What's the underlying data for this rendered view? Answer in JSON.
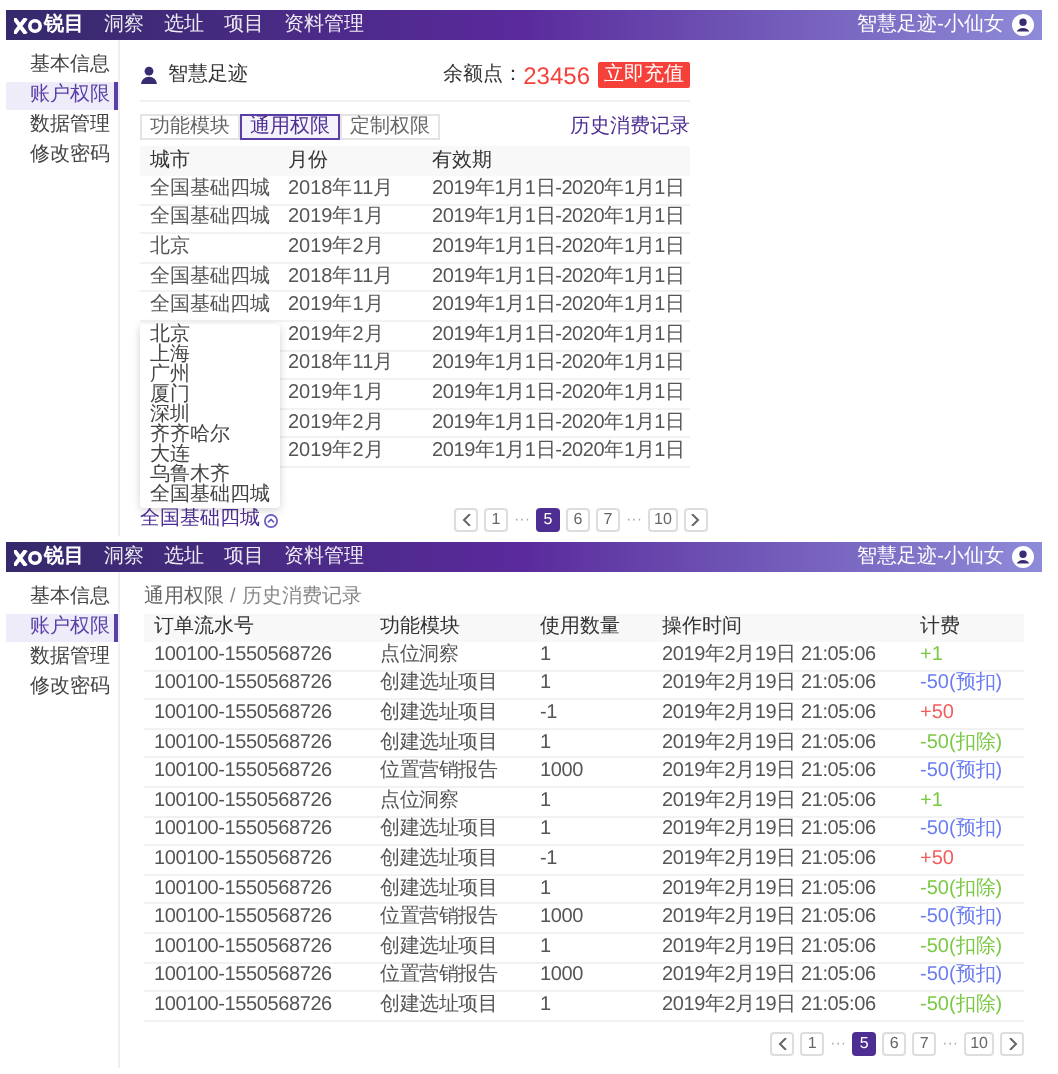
{
  "account_page": {
    "nav": {
      "logo": "锐目",
      "items": [
        "洞察",
        "选址",
        "项目",
        "资料管理"
      ],
      "user": "智慧足迹-小仙女"
    },
    "sidebar": [
      {
        "label": "基本信息",
        "selected": false
      },
      {
        "label": "账户权限",
        "selected": true
      },
      {
        "label": "数据管理",
        "selected": false
      },
      {
        "label": "修改密码",
        "selected": false
      }
    ],
    "account_name": "智慧足迹",
    "points_label": "余额点：",
    "points": "23456",
    "recharge_button": "立即充值",
    "tabs": [
      {
        "label": "功能模块",
        "selected": false
      },
      {
        "label": "通用权限",
        "selected": true
      },
      {
        "label": "定制权限",
        "selected": false
      }
    ],
    "history_link": "历史消费记录",
    "table": {
      "columns": [
        "城市",
        "月份",
        "有效期"
      ],
      "rows": [
        {
          "city": "全国基础四城",
          "month": "2018年11月",
          "validity": "2019年1月1日-2020年1月1日"
        },
        {
          "city": "全国基础四城",
          "month": "2019年1月",
          "validity": "2019年1月1日-2020年1月1日"
        },
        {
          "city": "北京",
          "month": "2019年2月",
          "validity": "2019年1月1日-2020年1月1日"
        },
        {
          "city": "全国基础四城",
          "month": "2018年11月",
          "validity": "2019年1月1日-2020年1月1日"
        },
        {
          "city": "全国基础四城",
          "month": "2019年1月",
          "validity": "2019年1月1日-2020年1月1日"
        },
        {
          "month": "2019年2月",
          "validity": "2019年1月1日-2020年1月1日"
        },
        {
          "month": "2018年11月",
          "validity": "2019年1月1日-2020年1月1日"
        },
        {
          "month": "2019年1月",
          "validity": "2019年1月1日-2020年1月1日"
        },
        {
          "month": "2019年2月",
          "validity": "2019年1月1日-2020年1月1日"
        },
        {
          "month": "2019年2月",
          "validity": "2019年1月1日-2020年1月1日"
        }
      ]
    },
    "city_dropdown": {
      "value": "全国基础四城",
      "expanded": true,
      "options": [
        "北京",
        "上海",
        "广州",
        "厦门",
        "深圳",
        "齐齐哈尔",
        "大连",
        "乌鲁木齐",
        "全国基础四城"
      ]
    },
    "pagination": [
      {
        "kind": "prev"
      },
      {
        "kind": "page",
        "label": "1",
        "selected": false
      },
      {
        "kind": "ellipsis",
        "label": "···"
      },
      {
        "kind": "page",
        "label": "5",
        "selected": true
      },
      {
        "kind": "page",
        "label": "6",
        "selected": false
      },
      {
        "kind": "page",
        "label": "7",
        "selected": false
      },
      {
        "kind": "ellipsis",
        "label": "···"
      },
      {
        "kind": "page",
        "label": "10",
        "selected": false
      },
      {
        "kind": "next"
      }
    ]
  },
  "history_page": {
    "nav": {
      "logo": "锐目",
      "items": [
        "洞察",
        "选址",
        "项目",
        "资料管理"
      ],
      "user": "智慧足迹-小仙女"
    },
    "sidebar": [
      {
        "label": "基本信息",
        "selected": false
      },
      {
        "label": "账户权限",
        "selected": true
      },
      {
        "label": "数据管理",
        "selected": false
      },
      {
        "label": "修改密码",
        "selected": false
      }
    ],
    "breadcrumb": [
      "通用权限",
      "/",
      "历史消费记录"
    ],
    "table": {
      "columns": [
        "订单流水号",
        "功能模块",
        "使用数量",
        "操作时间",
        "计费"
      ],
      "rows": [
        {
          "order": "100100-1550568726",
          "module": "点位洞察",
          "quantity": "1",
          "time": "2019年2月19日 21:05:06",
          "charge": "+1",
          "color": "#7ac943"
        },
        {
          "order": "100100-1550568726",
          "module": "创建选址项目",
          "quantity": "1",
          "time": "2019年2月19日 21:05:06",
          "charge": "-50(预扣)",
          "color": "#6b7cf0"
        },
        {
          "order": "100100-1550568726",
          "module": "创建选址项目",
          "quantity": "-1",
          "time": "2019年2月19日 21:05:06",
          "charge": "+50",
          "color": "#f25c5c"
        },
        {
          "order": "100100-1550568726",
          "module": "创建选址项目",
          "quantity": "1",
          "time": "2019年2月19日 21:05:06",
          "charge": "-50(扣除)",
          "color": "#7ac943"
        },
        {
          "order": "100100-1550568726",
          "module": "位置营销报告",
          "quantity": "1000",
          "time": "2019年2月19日 21:05:06",
          "charge": "-50(预扣)",
          "color": "#6b7cf0"
        },
        {
          "order": "100100-1550568726",
          "module": "点位洞察",
          "quantity": "1",
          "time": "2019年2月19日 21:05:06",
          "charge": "+1",
          "color": "#7ac943"
        },
        {
          "order": "100100-1550568726",
          "module": "创建选址项目",
          "quantity": "1",
          "time": "2019年2月19日 21:05:06",
          "charge": "-50(预扣)",
          "color": "#6b7cf0"
        },
        {
          "order": "100100-1550568726",
          "module": "创建选址项目",
          "quantity": "-1",
          "time": "2019年2月19日 21:05:06",
          "charge": "+50",
          "color": "#f25c5c"
        },
        {
          "order": "100100-1550568726",
          "module": "创建选址项目",
          "quantity": "1",
          "time": "2019年2月19日 21:05:06",
          "charge": "-50(扣除)",
          "color": "#7ac943"
        },
        {
          "order": "100100-1550568726",
          "module": "位置营销报告",
          "quantity": "1000",
          "time": "2019年2月19日 21:05:06",
          "charge": "-50(预扣)",
          "color": "#6b7cf0"
        },
        {
          "order": "100100-1550568726",
          "module": "创建选址项目",
          "quantity": "1",
          "time": "2019年2月19日 21:05:06",
          "charge": "-50(扣除)",
          "color": "#7ac943"
        },
        {
          "order": "100100-1550568726",
          "module": "位置营销报告",
          "quantity": "1000",
          "time": "2019年2月19日 21:05:06",
          "charge": "-50(预扣)",
          "color": "#6b7cf0"
        },
        {
          "order": "100100-1550568726",
          "module": "创建选址项目",
          "quantity": "1",
          "time": "2019年2月19日 21:05:06",
          "charge": "-50(扣除)",
          "color": "#7ac943"
        }
      ]
    },
    "pagination": [
      {
        "kind": "prev"
      },
      {
        "kind": "page",
        "label": "1",
        "selected": false
      },
      {
        "kind": "ellipsis",
        "label": "···"
      },
      {
        "kind": "page",
        "label": "5",
        "selected": true
      },
      {
        "kind": "page",
        "label": "6",
        "selected": false
      },
      {
        "kind": "page",
        "label": "7",
        "selected": false
      },
      {
        "kind": "ellipsis",
        "label": "···"
      },
      {
        "kind": "page",
        "label": "10",
        "selected": false
      },
      {
        "kind": "next"
      }
    ]
  }
}
